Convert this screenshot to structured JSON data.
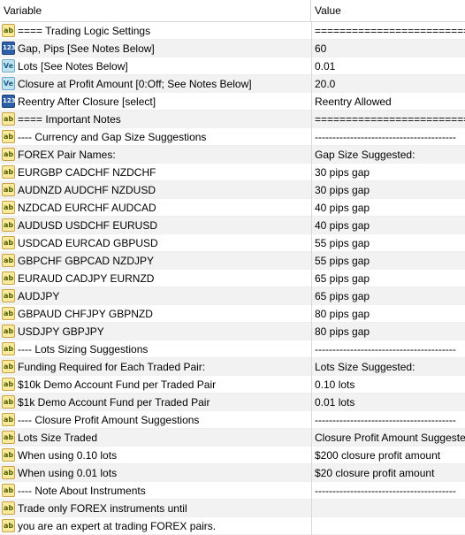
{
  "header": {
    "variable": "Variable",
    "value": "Value"
  },
  "rows": [
    {
      "icon": "ab",
      "name": "==== Trading Logic Settings",
      "value": "================================"
    },
    {
      "icon": "123",
      "name": "Gap, Pips [See Notes Below]",
      "value": "60"
    },
    {
      "icon": "Ve",
      "name": "Lots [See Notes Below]",
      "value": "0.01"
    },
    {
      "icon": "Ve",
      "name": "Closure at Profit Amount [0:Off; See Notes Below]",
      "value": "20.0"
    },
    {
      "icon": "123",
      "name": "Reentry After Closure [select]",
      "value": "Reentry Allowed"
    },
    {
      "icon": "ab",
      "name": "==== Important Notes",
      "value": "================================"
    },
    {
      "icon": "ab",
      "name": "---- Currency and Gap Size Suggestions",
      "value": "----------------------------------------"
    },
    {
      "icon": "ab",
      "name": "FOREX Pair Names:",
      "value": "Gap Size Suggested:"
    },
    {
      "icon": "ab",
      "name": "EURGBP CADCHF NZDCHF",
      "value": "30 pips gap"
    },
    {
      "icon": "ab",
      "name": "AUDNZD AUDCHF NZDUSD",
      "value": "30 pips gap"
    },
    {
      "icon": "ab",
      "name": "NZDCAD EURCHF AUDCAD",
      "value": "40 pips gap"
    },
    {
      "icon": "ab",
      "name": "AUDUSD USDCHF EURUSD",
      "value": "40 pips gap"
    },
    {
      "icon": "ab",
      "name": "USDCAD EURCAD GBPUSD",
      "value": "55 pips gap"
    },
    {
      "icon": "ab",
      "name": "GBPCHF GBPCAD NZDJPY",
      "value": "55 pips gap"
    },
    {
      "icon": "ab",
      "name": "EURAUD CADJPY EURNZD",
      "value": "65 pips gap"
    },
    {
      "icon": "ab",
      "name": "AUDJPY",
      "value": "65 pips gap"
    },
    {
      "icon": "ab",
      "name": "GBPAUD CHFJPY GBPNZD",
      "value": "80 pips gap"
    },
    {
      "icon": "ab",
      "name": "USDJPY GBPJPY",
      "value": "80 pips gap"
    },
    {
      "icon": "ab",
      "name": "---- Lots Sizing Suggestions",
      "value": "----------------------------------------"
    },
    {
      "icon": "ab",
      "name": "Funding Required for Each Traded Pair:",
      "value": "Lots Size Suggested:"
    },
    {
      "icon": "ab",
      "name": "$10k Demo Account Fund per Traded Pair",
      "value": "0.10 lots"
    },
    {
      "icon": "ab",
      "name": "$1k Demo Account Fund per Traded Pair",
      "value": "0.01 lots"
    },
    {
      "icon": "ab",
      "name": "---- Closure Profit Amount Suggestions",
      "value": "----------------------------------------"
    },
    {
      "icon": "ab",
      "name": "Lots Size Traded",
      "value": "Closure Profit Amount Suggested:"
    },
    {
      "icon": "ab",
      "name": "When using 0.10 lots",
      "value": "$200 closure profit amount"
    },
    {
      "icon": "ab",
      "name": "When using 0.01 lots",
      "value": "$20 closure profit amount"
    },
    {
      "icon": "ab",
      "name": "---- Note About Instruments",
      "value": "----------------------------------------"
    },
    {
      "icon": "ab",
      "name": "Trade only FOREX instruments until",
      "value": ""
    },
    {
      "icon": "ab",
      "name": "you are an expert at trading FOREX pairs.",
      "value": ""
    }
  ]
}
